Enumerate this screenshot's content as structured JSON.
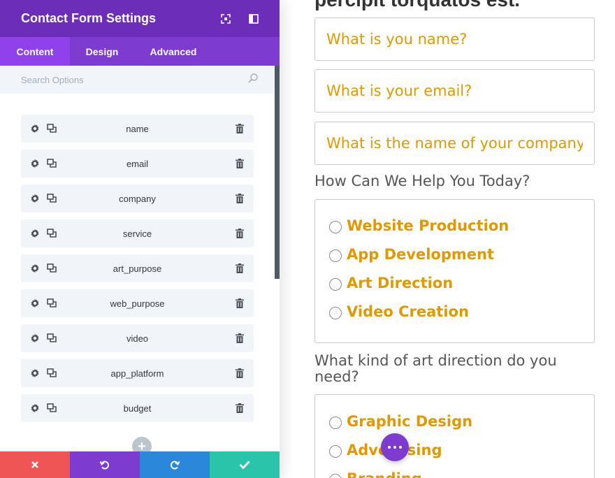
{
  "panel": {
    "title": "Contact Form Settings",
    "header_icons": [
      "expand-icon",
      "sidebar-toggle-icon"
    ],
    "tabs": [
      {
        "label": "Content",
        "active": true
      },
      {
        "label": "Design",
        "active": false
      },
      {
        "label": "Advanced",
        "active": false
      }
    ],
    "search_placeholder": "Search Options",
    "fields": [
      {
        "label": "name"
      },
      {
        "label": "email"
      },
      {
        "label": "company"
      },
      {
        "label": "service"
      },
      {
        "label": "art_purpose"
      },
      {
        "label": "web_purpose"
      },
      {
        "label": "video"
      },
      {
        "label": "app_platform"
      },
      {
        "label": "budget"
      }
    ],
    "add_symbol": "+",
    "footer": {
      "cancel_icon": "close-icon",
      "undo_icon": "undo-icon",
      "redo_icon": "redo-icon",
      "save_icon": "checkmark-icon"
    }
  },
  "preview": {
    "heading": "percipit torquatos est.",
    "inputs": [
      {
        "placeholder": "What is you name?"
      },
      {
        "placeholder": "What is your email?"
      },
      {
        "placeholder": "What is the name of your company?"
      }
    ],
    "question1": "How Can We Help You Today?",
    "options1": [
      "Website Production",
      "App Development",
      "Art Direction",
      "Video Creation"
    ],
    "question2": "What kind of art direction do you need?",
    "options2": [
      "Graphic Design",
      "Advertising",
      "Branding"
    ]
  },
  "colors": {
    "header": "#6c2eb9",
    "tabs": "#7d3bcf",
    "active_tab": "#8f42ec",
    "accent_text": "#e09900",
    "cancel": "#ef5555",
    "undo": "#7d3bcf",
    "redo": "#2b87da",
    "save": "#29c4a9"
  }
}
